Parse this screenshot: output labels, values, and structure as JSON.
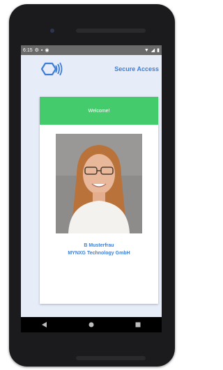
{
  "status_bar": {
    "time": "6:15",
    "left_icons": [
      "settings-icon",
      "sim-icon",
      "location-icon"
    ],
    "right_icons": [
      "wifi-icon",
      "signal-icon",
      "battery-icon"
    ]
  },
  "header": {
    "title": "Secure Access",
    "logo": "nfc-hexagon-logo"
  },
  "card": {
    "banner": "Welcome!",
    "name": "B Musterfrau",
    "company": "MYNXG Technology GmbH",
    "photo": "user-portrait"
  },
  "nav_bar": {
    "buttons": [
      "back-icon",
      "home-icon",
      "recents-icon"
    ]
  },
  "colors": {
    "accent": "#3f7ed6",
    "banner": "#44cc6c",
    "screen_bg": "#e6ecf8"
  }
}
